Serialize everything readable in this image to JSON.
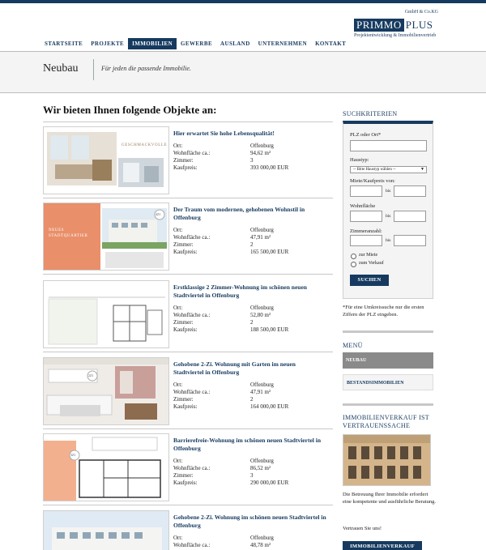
{
  "brand": {
    "gmbh": "GmbH & Co.KG",
    "name_primary": "PRIMMO",
    "name_secondary": "PLUS",
    "tagline": "Projektentwicklung & Immobilienvertrieb"
  },
  "nav": {
    "items": [
      {
        "label": "STARTSEITE"
      },
      {
        "label": "PROJEKTE"
      },
      {
        "label": "IMMOBILIEN",
        "active": true
      },
      {
        "label": "GEWERBE"
      },
      {
        "label": "AUSLAND"
      },
      {
        "label": "UNTERNEHMEN"
      },
      {
        "label": "KONTAKT"
      }
    ]
  },
  "hero": {
    "title": "Neubau",
    "tagline": "Für jeden die passende Immobilie."
  },
  "main": {
    "heading": "Wir bieten Ihnen folgende Objekte an:",
    "field_labels": {
      "ort": "Ort:",
      "flaeche": "Wohnfläche ca.:",
      "zimmer": "Zimmer:",
      "preis": "Kaufpreis:"
    },
    "listings": [
      {
        "title": "Hier erwartet Sie hohe Lebensqualität!",
        "ort": "Offenburg",
        "flaeche": "94,62 m²",
        "zimmer": "3",
        "preis": "393 000,00 EUR",
        "thumb_text": "GESCHMACKVOLLE",
        "thumb_kind": "interior"
      },
      {
        "title": "Der Traum vom modernen, gehobenen Wohnstil in Offenburg",
        "ort": "Offenburg",
        "flaeche": "47,91 m²",
        "zimmer": "2",
        "preis": "165 500,00 EUR",
        "thumb_text": "NEUES STADTQUARTIER",
        "thumb_badge": "4ZI",
        "thumb_kind": "exterior"
      },
      {
        "title": "Erstklassige 2 Zimmer-Wohnung im schönen neuen Stadtviertel in Offenburg",
        "ort": "Offenburg",
        "flaeche": "52,80 m²",
        "zimmer": "2",
        "preis": "188 500,00 EUR",
        "thumb_kind": "plan"
      },
      {
        "title": "Gehobene 2-Zi. Wohnung mit Garten im neuen Stadtviertel in Offenburg",
        "ort": "Offenburg",
        "flaeche": "47,91 m²",
        "zimmer": "2",
        "preis": "164 000,00 EUR",
        "thumb_badge": "2ZI",
        "thumb_kind": "kitchen"
      },
      {
        "title": "Barrierefreie-Wohnung im schönen neuen Stadtviertel in Offenburg",
        "ort": "Offenburg",
        "flaeche": "86,52 m²",
        "zimmer": "3",
        "preis": "290 000,00 EUR",
        "thumb_badge": "3ZI",
        "thumb_kind": "floorplan"
      },
      {
        "title": "Gehobene 2-Zi. Wohnung im schönen neuen Stadtviertel in Offenburg",
        "ort": "Offenburg",
        "flaeche": "48,78 m²",
        "zimmer": "",
        "preis": "",
        "thumb_kind": "building"
      }
    ]
  },
  "sidebar": {
    "search_heading": "SUCHKRITERIEN",
    "plz_label": "PLZ oder Ort*",
    "plz_value": "",
    "haustyp_label": "Haustyp:",
    "haustyp_selected": "-- Bitte Haustyp wählen --",
    "miete_label": "Miete/Kaufpreis von:",
    "flaeche_label": "Wohnfläche",
    "zimmer_label": "Zimmeranzahl:",
    "bis": "bis",
    "radio_miete": "zur Miete",
    "radio_verkauf": "zum Verkauf",
    "search_button": "SUCHEN",
    "note": "*Für eine Umkreissuche nur die ersten Ziffern der PLZ eingeben.",
    "menu_heading": "MENÜ",
    "menu_items": [
      {
        "label": "NEUBAU",
        "active": true
      },
      {
        "label": "BESTANDSIMMOBILIEN",
        "active": false
      }
    ],
    "promo_heading": "IMMOBILIENVERKAUF IST VERTRAUENSSACHE",
    "promo_text": "Die Betreuung Ihrer Immobilie erfordert eine kompetente und ausführliche Beratung.",
    "promo_trust": "Vertrauen Sie uns!",
    "promo_button": "IMMOBILIENVERKAUF"
  },
  "colors": {
    "brand": "#163a5f",
    "accent_orange": "#e98f6a",
    "menu_active": "#8a8a8a"
  }
}
